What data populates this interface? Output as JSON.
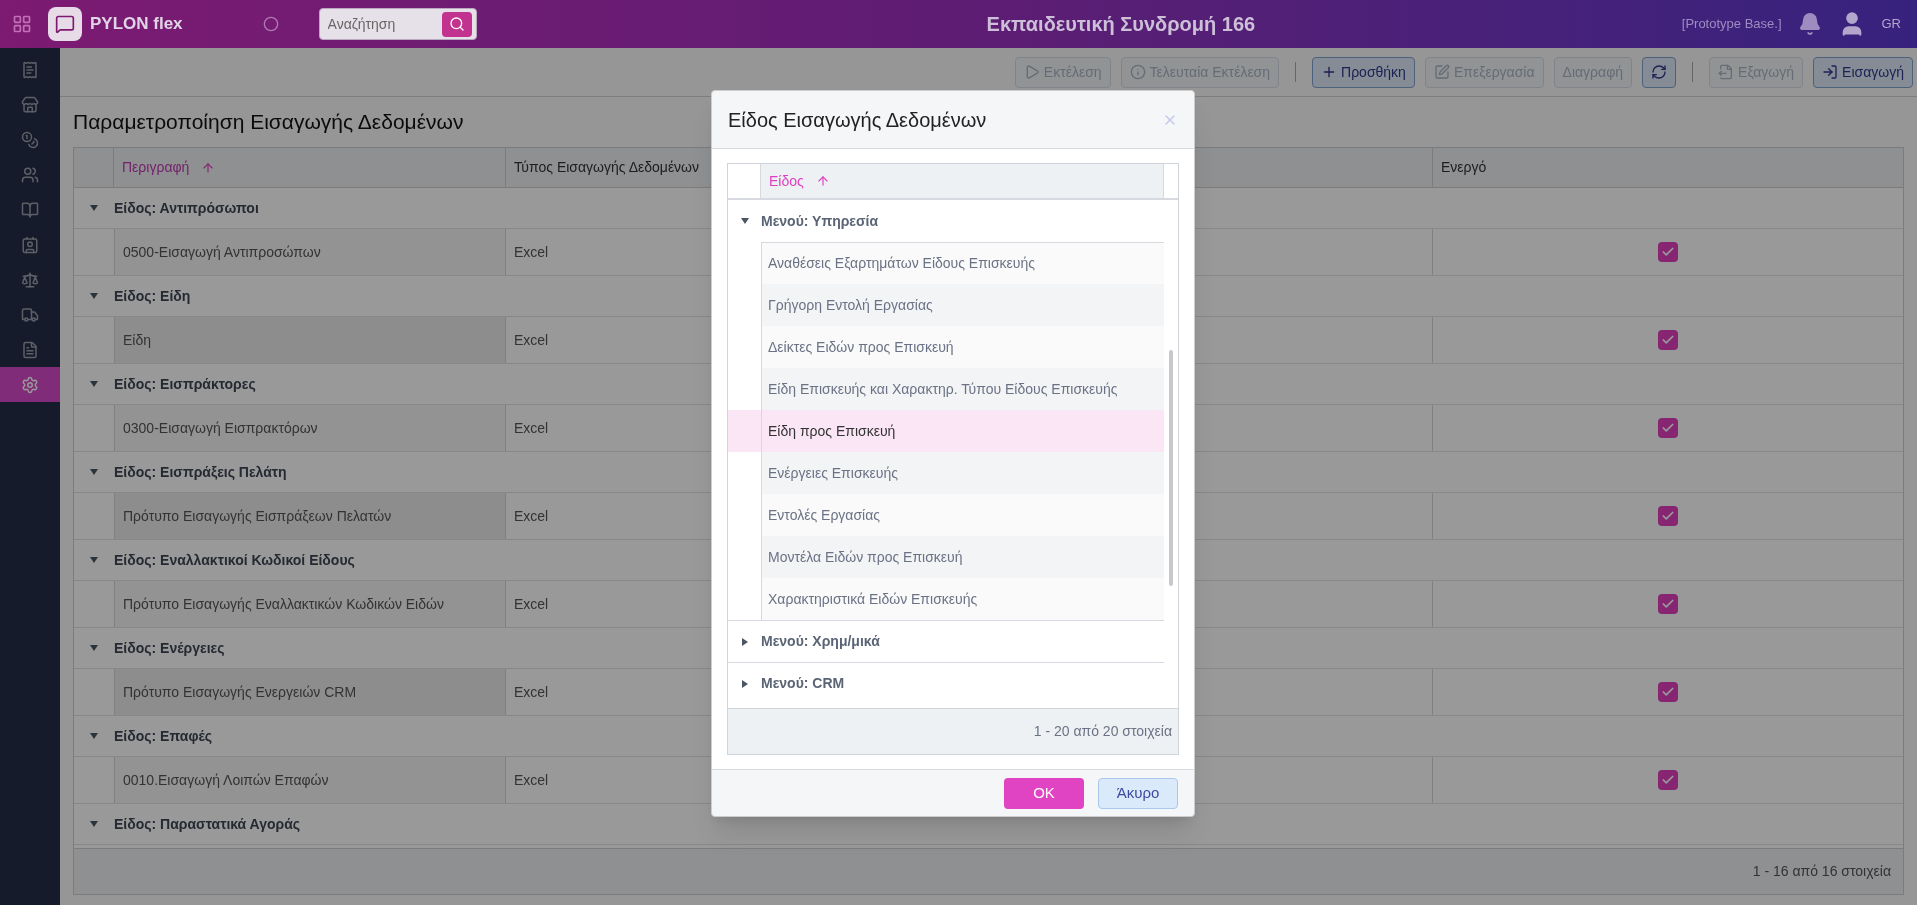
{
  "app": {
    "brand": "PYLON flex",
    "search": {
      "placeholder": "Αναζήτηση"
    },
    "title": "Εκπαιδευτική Συνδρομή 166",
    "database": "[Prototype Base.]",
    "language": "GR"
  },
  "sidebar": {
    "items": [
      {
        "kind": "receipt",
        "selected": false
      },
      {
        "kind": "store",
        "selected": false
      },
      {
        "kind": "coins",
        "selected": false
      },
      {
        "kind": "people",
        "selected": false
      },
      {
        "kind": "book",
        "selected": false
      },
      {
        "kind": "contact",
        "selected": false
      },
      {
        "kind": "scale",
        "selected": false
      },
      {
        "kind": "truck",
        "selected": false
      },
      {
        "kind": "document",
        "selected": false
      },
      {
        "kind": "settings",
        "selected": true
      }
    ]
  },
  "toolbar": {
    "buttons": [
      {
        "kind": "run",
        "label": "Εκτέλεση",
        "disabled": true
      },
      {
        "kind": "info",
        "label": "Τελευταία Εκτέλεση",
        "disabled": true
      },
      {
        "kind": "separator"
      },
      {
        "kind": "add",
        "label": "Προσθήκη",
        "disabled": false
      },
      {
        "kind": "edit",
        "label": "Επεξεργασία",
        "disabled": true
      },
      {
        "kind": "plain",
        "label": "Διαγραφή",
        "disabled": true
      },
      {
        "kind": "refresh",
        "disabled": false
      },
      {
        "kind": "separator"
      },
      {
        "kind": "export",
        "label": "Εξαγωγή",
        "disabled": true
      },
      {
        "kind": "import",
        "label": "Εισαγωγή",
        "disabled": false
      }
    ]
  },
  "page": {
    "title": "Παραμετροποίηση Εισαγωγής Δεδομένων",
    "table": {
      "columns": [
        {
          "label": "Περιγραφή",
          "sorted": true
        },
        {
          "label": "Τύπος Εισαγωγής Δεδομένων",
          "sorted": false
        },
        {
          "label": "Ενεργό",
          "sorted": false
        }
      ],
      "groups": [
        {
          "label": "Είδος: Αντιπρόσωποι",
          "expanded": true,
          "rows": [
            {
              "description": "0500-Εισαγωγή Αντιπροσώπων",
              "type": "Excel",
              "active": true
            }
          ]
        },
        {
          "label": "Είδος: Είδη",
          "expanded": true,
          "rows": [
            {
              "description": "Είδη",
              "type": "Excel",
              "active": true
            }
          ]
        },
        {
          "label": "Είδος: Εισπράκτορες",
          "expanded": true,
          "rows": [
            {
              "description": "0300-Εισαγωγή Εισπρακτόρων",
              "type": "Excel",
              "active": true
            }
          ]
        },
        {
          "label": "Είδος: Εισπράξεις Πελάτη",
          "expanded": true,
          "rows": [
            {
              "description": "Πρότυπο Εισαγωγής Εισπράξεων Πελατών",
              "type": "Excel",
              "active": true
            }
          ]
        },
        {
          "label": "Είδος: Εναλλακτικοί Κωδικοί Είδους",
          "expanded": true,
          "rows": [
            {
              "description": "Πρότυπο Εισαγωγής Εναλλακτικών Κωδικών Ειδών",
              "type": "Excel",
              "active": true
            }
          ]
        },
        {
          "label": "Είδος: Ενέργειες",
          "expanded": true,
          "rows": [
            {
              "description": "Πρότυπο Εισαγωγής Ενεργειών CRM",
              "type": "Excel",
              "active": true
            }
          ]
        },
        {
          "label": "Είδος: Επαφές",
          "expanded": true,
          "rows": [
            {
              "description": "0010.Εισαγωγή Λοιπών Επαφών",
              "type": "Excel",
              "active": true
            }
          ]
        },
        {
          "label": "Είδος: Παραστατικά Αγοράς",
          "expanded": true
        }
      ],
      "pager": "1 - 16 από 16 στοιχεία"
    }
  },
  "dialog": {
    "title": "Είδος Εισαγωγής Δεδομένων",
    "column": {
      "label": "Είδος",
      "sorted": true
    },
    "groups": [
      {
        "label": "Μενού: Υπηρεσία",
        "expanded": true,
        "items": [
          {
            "label": "Αναθέσεις Εξαρτημάτων Είδους Επισκευής",
            "selected": false
          },
          {
            "label": "Γρήγορη Εντολή Εργασίας",
            "selected": false
          },
          {
            "label": "Δείκτες Ειδών προς Επισκευή",
            "selected": false
          },
          {
            "label": "Είδη Επισκευής και Χαρακτηρ. Τύπου Είδους Επισκευής",
            "selected": false
          },
          {
            "label": "Είδη προς Επισκευή",
            "selected": true
          },
          {
            "label": "Ενέργειες Επισκευής",
            "selected": false
          },
          {
            "label": "Εντολές Εργασίας",
            "selected": false
          },
          {
            "label": "Μοντέλα Ειδών προς Επισκευή",
            "selected": false
          },
          {
            "label": "Χαρακτηριστικά Ειδών Επισκευής",
            "selected": false
          }
        ]
      },
      {
        "label": "Μενού: Χρημ/μικά",
        "expanded": false
      },
      {
        "label": "Μενού: CRM",
        "expanded": false
      }
    ],
    "pager": "1 - 20 από 20 στοιχεία",
    "buttons": [
      {
        "kind": "primary",
        "label": "OK"
      },
      {
        "kind": "secondary",
        "label": "Άκυρο"
      }
    ]
  }
}
